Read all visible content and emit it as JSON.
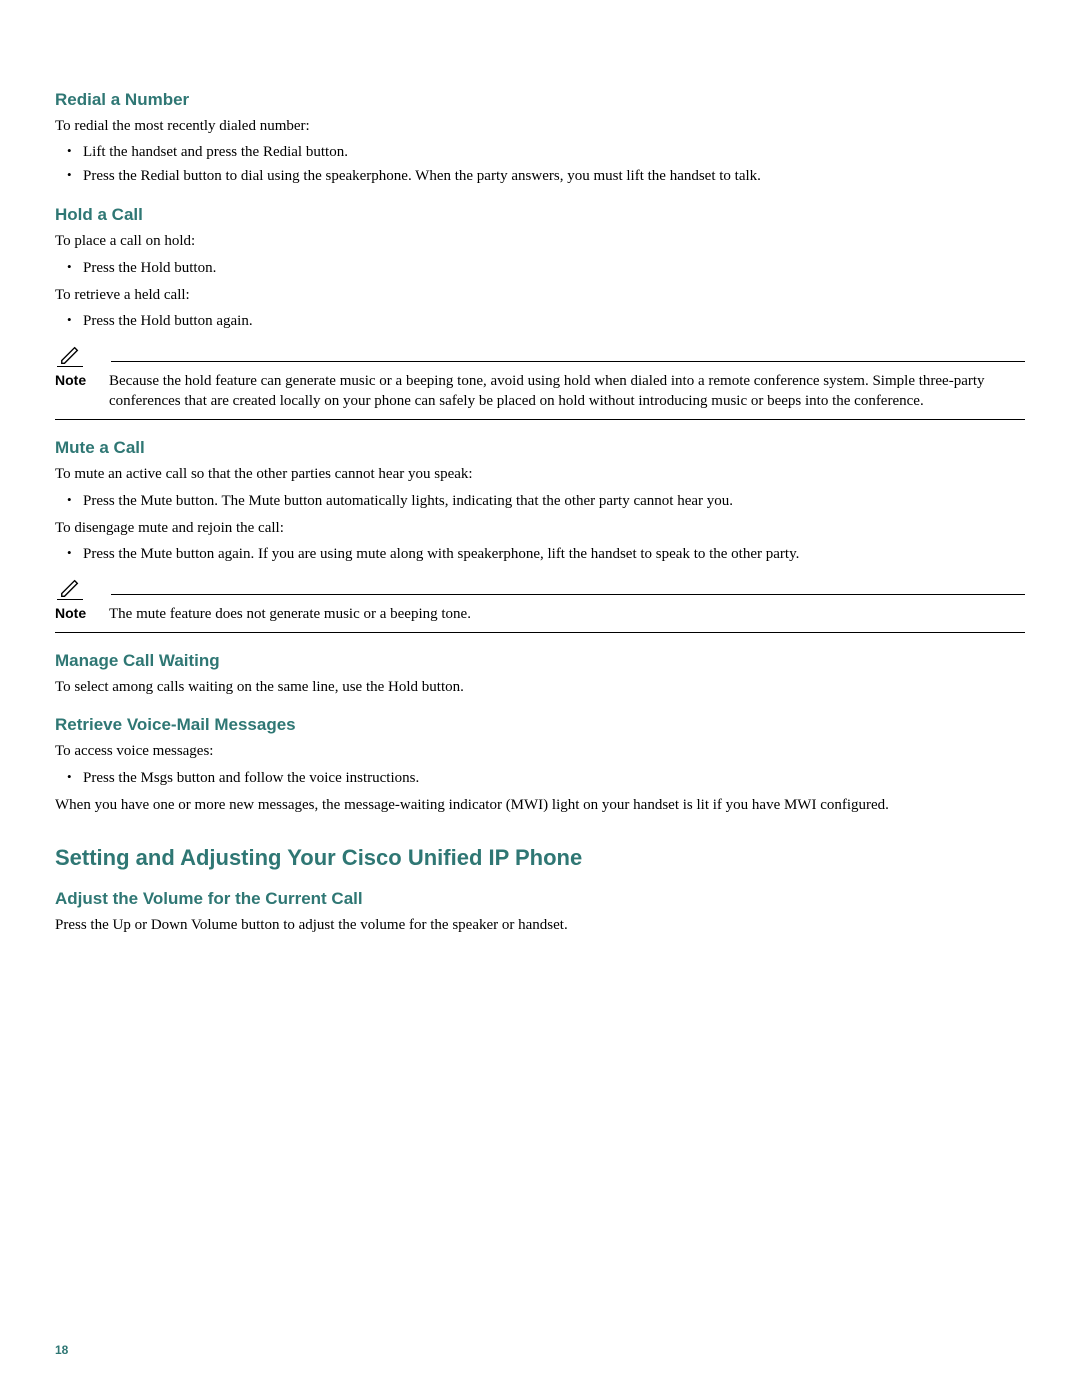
{
  "sections": {
    "redial": {
      "heading": "Redial a Number",
      "intro": "To redial the most recently dialed number:",
      "bullets": [
        "Lift the handset and press the Redial button.",
        "Press the Redial button to dial using the speakerphone. When the party answers, you must lift the handset to talk."
      ]
    },
    "hold": {
      "heading": "Hold a Call",
      "intro1": "To place a call on hold:",
      "bullets1": [
        "Press the Hold button."
      ],
      "intro2": "To retrieve a held call:",
      "bullets2": [
        "Press the Hold button again."
      ],
      "note_label": "Note",
      "note_text": "Because the hold feature can generate music or a beeping tone, avoid using hold when dialed into a remote conference system. Simple three-party conferences that are created locally on your phone can safely be placed on hold without introducing music or beeps into the conference."
    },
    "mute": {
      "heading": "Mute a Call",
      "intro1": "To mute an active call so that the other parties cannot hear you speak:",
      "bullets1": [
        "Press the Mute button. The Mute button automatically lights, indicating that the other party cannot hear you."
      ],
      "intro2": "To disengage mute and rejoin the call:",
      "bullets2": [
        "Press the Mute button again. If you are using mute along with speakerphone, lift the handset to speak to the other party."
      ],
      "note_label": "Note",
      "note_text": "The mute feature does not generate music or a beeping tone."
    },
    "callwaiting": {
      "heading": "Manage Call Waiting",
      "body": "To select among calls waiting on the same line, use the Hold button."
    },
    "voicemail": {
      "heading": "Retrieve Voice-Mail Messages",
      "intro": "To access voice messages:",
      "bullets": [
        "Press the Msgs button and follow the voice instructions."
      ],
      "after": "When you have one or more new messages, the message-waiting indicator (MWI) light on your handset is lit if you have MWI configured."
    },
    "settings_main": {
      "heading": "Setting and Adjusting Your Cisco Unified IP Phone"
    },
    "adjust_volume": {
      "heading": "Adjust the Volume for the Current Call",
      "body": "Press the Up or Down Volume button to adjust the volume for the speaker or handset."
    }
  },
  "page_number": "18"
}
